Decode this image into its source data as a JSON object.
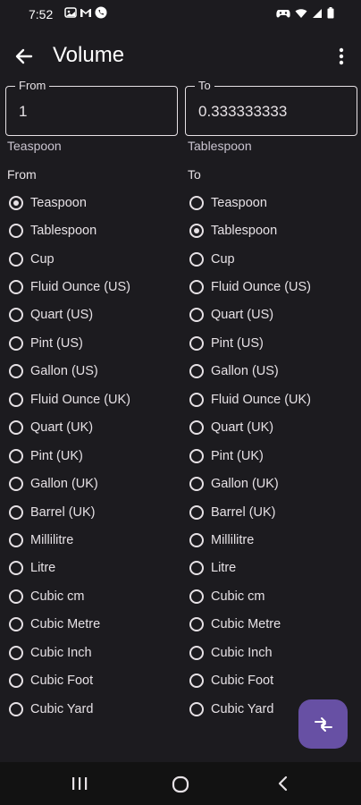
{
  "status_bar": {
    "time": "7:52",
    "left_icons": [
      "photo-icon",
      "gmail-icon",
      "phone-icon"
    ],
    "right_icons": [
      "game-icon",
      "wifi-icon",
      "signal-icon",
      "battery-icon"
    ]
  },
  "app_bar": {
    "title": "Volume"
  },
  "from_field": {
    "label": "From",
    "value": "1",
    "unit": "Teaspoon"
  },
  "to_field": {
    "label": "To",
    "value": "0.333333333",
    "unit": "Tablespoon"
  },
  "from_section_label": "From",
  "to_section_label": "To",
  "units": [
    "Teaspoon",
    "Tablespoon",
    "Cup",
    "Fluid Ounce (US)",
    "Quart (US)",
    "Pint (US)",
    "Gallon (US)",
    "Fluid Ounce (UK)",
    "Quart (UK)",
    "Pint (UK)",
    "Gallon (UK)",
    "Barrel (UK)",
    "Millilitre",
    "Litre",
    "Cubic cm",
    "Cubic Metre",
    "Cubic Inch",
    "Cubic Foot",
    "Cubic Yard"
  ],
  "selected_from": "Teaspoon",
  "selected_to": "Tablespoon",
  "colors": {
    "background": "#1c1b1f",
    "fab": "#6750a4",
    "text": "#e6e1e5"
  }
}
